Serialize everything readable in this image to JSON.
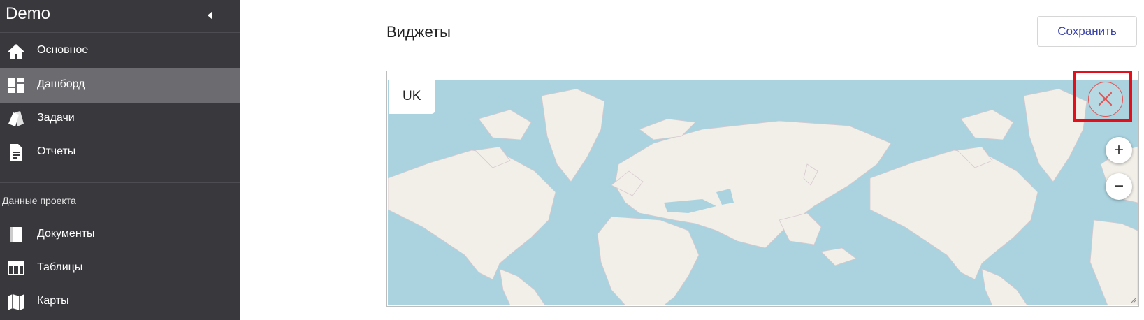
{
  "sidebar": {
    "app_title": "Demo",
    "collapse_icon": "caret-left-icon",
    "items": [
      {
        "label": "Основное",
        "icon": "home-icon",
        "active": false
      },
      {
        "label": "Дашборд",
        "icon": "dashboard-icon",
        "active": true
      },
      {
        "label": "Задачи",
        "icon": "tags-icon",
        "active": false
      },
      {
        "label": "Отчеты",
        "icon": "document-icon",
        "active": false
      }
    ],
    "section_label": "Данные проекта",
    "project_items": [
      {
        "label": "Документы",
        "icon": "book-icon"
      },
      {
        "label": "Таблицы",
        "icon": "table-icon"
      },
      {
        "label": "Карты",
        "icon": "map-icon"
      }
    ]
  },
  "main": {
    "title": "Виджеты",
    "save_label": "Сохранить"
  },
  "widget": {
    "tab_label": "UK",
    "remove_icon": "close-icon",
    "zoom_in_label": "+",
    "zoom_out_label": "−"
  },
  "colors": {
    "sidebar_bg": "#38383d",
    "sidebar_active": "#6c6b70",
    "accent": "#3b44a8",
    "highlight": "#e3101c",
    "water": "#aad3df",
    "land": "#f2efe9"
  }
}
